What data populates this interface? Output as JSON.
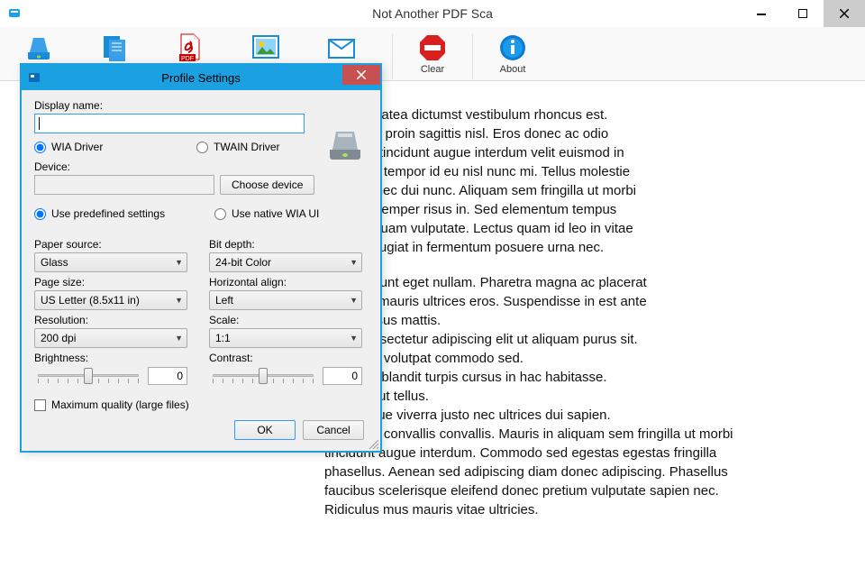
{
  "window": {
    "title": "Not Another PDF Sca"
  },
  "toolbar": {
    "pdf_suffix": "PDF",
    "clear": "Clear",
    "about": "About"
  },
  "content": {
    "p1": "bitasse platea dictumst vestibulum rhoncus est.\ncing vitae proin sagittis nisl. Eros donec ac odio\nUt morbi tincidunt augue interdum velit euismod in\nollicitudin tempor id eu nisl nunc mi. Tellus molestie\nsa enim nec dui nunc. Aliquam sem fringilla ut morbi\nc sed id semper risus in. Sed elementum tempus\npretium quam vulputate. Lectus quam id leo in vitae\nus nec feugiat in fermentum posuere urna nec.",
    "p2": "nisl tincidunt eget nullam. Pharetra magna ac placerat\nm lectus mauris ultrices eros. Suspendisse in est ante\nauris cursus mattis.\namet consectetur adipiscing elit ut aliquam purus sit.\nque diam volutpat commodo sed.\nvida quis blandit turpis cursus in hac habitasse.\nttis enim ut tellus.\nurna neque viverra justo nec ultrices dui sapien.\nurna duis convallis convallis. Mauris in aliquam sem fringilla ut morbi tincidunt augue interdum. Commodo sed egestas egestas fringilla phasellus. Aenean sed adipiscing diam donec adipiscing. Phasellus faucibus scelerisque eleifend donec pretium vulputate sapien nec. Ridiculus mus mauris vitae ultricies."
  },
  "dialog": {
    "title": "Profile Settings",
    "display_name_label": "Display name:",
    "display_name_value": "",
    "radio_wia": "WIA Driver",
    "radio_twain": "TWAIN Driver",
    "device_label": "Device:",
    "device_value": "",
    "choose_device": "Choose device",
    "radio_predefined": "Use predefined settings",
    "radio_native": "Use native WIA UI",
    "paper_source_label": "Paper source:",
    "paper_source_value": "Glass",
    "page_size_label": "Page size:",
    "page_size_value": "US Letter (8.5x11 in)",
    "resolution_label": "Resolution:",
    "resolution_value": "200 dpi",
    "brightness_label": "Brightness:",
    "brightness_value": "0",
    "bit_depth_label": "Bit depth:",
    "bit_depth_value": "24-bit Color",
    "halign_label": "Horizontal align:",
    "halign_value": "Left",
    "scale_label": "Scale:",
    "scale_value": "1:1",
    "contrast_label": "Contrast:",
    "contrast_value": "0",
    "max_quality": "Maximum quality (large files)",
    "ok": "OK",
    "cancel": "Cancel"
  }
}
